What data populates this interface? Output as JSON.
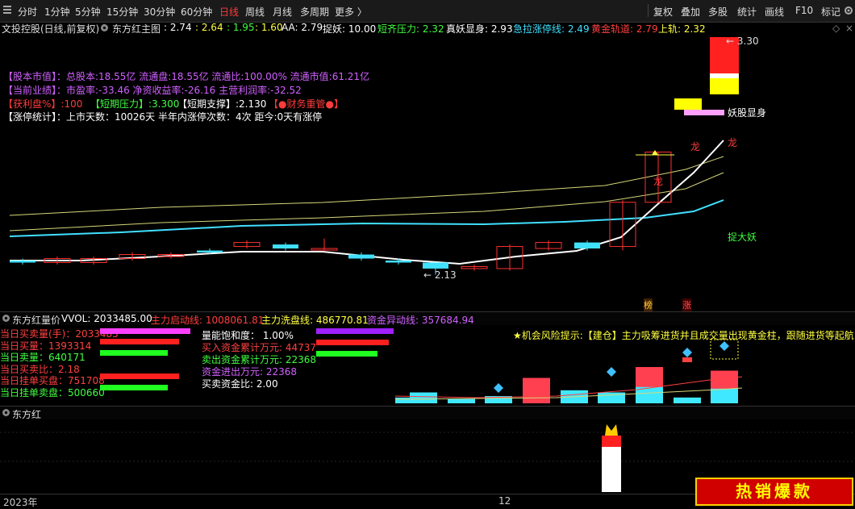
{
  "toolbar": {
    "menu_icon": "menu-icon",
    "tabs": [
      "分时",
      "1分钟",
      "5分钟",
      "15分钟",
      "30分钟",
      "60分钟",
      "日线",
      "周线",
      "月线",
      "多周期",
      "更多 〉"
    ],
    "right": [
      "复权",
      "叠加",
      "多股",
      "统计",
      "画线",
      "F10",
      "标记"
    ],
    "settings_icon": "gear-icon"
  },
  "main_header": {
    "stock": "文投控股(日线,前复权)",
    "indicator": "东方红主图",
    "vals": [
      ": 2.74",
      ": 2.64",
      ": 1.95",
      ": 1.60"
    ],
    "aa": "AA: 2.79",
    "zhuoyao": "捉妖: 10.00",
    "dqyl": "短齐压力: 2.32",
    "zyxs": "真妖显身: 2.93",
    "jlzt": "急拉涨停线: 2.49",
    "hjgd": "黄金轨道: 2.79",
    "sg": "上轨: 2.32"
  },
  "info_lines": {
    "l1": "【股本市值】：总股本:18.55亿 流通盘:18.55亿 流通比:100.00% 流通市值:61.21亿",
    "l2": "【当前业绩】：市盈率:-33.46 净资收益率:-26.16 主营利润率:-32.52",
    "l3a": "【获利盘%】:100",
    "l3b": "【短期压力】:3.300",
    "l3c": "【短期支撑】:2.130",
    "l3d": "【●财务重管●】",
    "l4": "【涨停统计】：上市天数：10026天 半年内涨停次数：4次   距今:0天有涨停"
  },
  "chart_labels": {
    "high": "← 3.30",
    "low": "← 2.13",
    "yao_show": "妖股显身",
    "long": "龙",
    "catch": "捉大妖",
    "bang": "榜",
    "zhang": "涨"
  },
  "vol_header": {
    "name": "东方红量价",
    "vvol": "VVOL: 2033485.00",
    "qd": "主力启动线: 1008061.81",
    "xp": "主力洗盘线: 486770.81",
    "yd": "资金异动线: 357684.94"
  },
  "vol_stats_left": [
    {
      "label": "当日买卖量(手)：2033485",
      "color": "#ff4040"
    },
    {
      "label": "当日买量：1393314",
      "color": "#ff4040"
    },
    {
      "label": "当日卖量：640171",
      "color": "#40ff40"
    },
    {
      "label": "当日买卖比：2.18",
      "color": "#ff4040"
    },
    {
      "label": "当日挂单买盘：751708",
      "color": "#ff4040"
    },
    {
      "label": "当日挂单卖盘：500660",
      "color": "#40ff40"
    }
  ],
  "vol_stats_mid": [
    {
      "label": "量能饱和度： 1.00%",
      "color": "#ffffff"
    },
    {
      "label": "买入资金累计万元: 44737",
      "color": "#ff4040"
    },
    {
      "label": "卖出资金累计万元: 22368",
      "color": "#40ff40"
    },
    {
      "label": "资金进出万元: 22368",
      "color": "#d060ff"
    },
    {
      "label": "买卖资金比: 2.00",
      "color": "#ffffff"
    }
  ],
  "vol_tip": "★机会风险提示:【建仓】主力吸筹进货并且成交量出现黄金柱，跟随进货等起航",
  "bottom_panel": {
    "name": "东方红"
  },
  "bottom_bar": {
    "year": "2023年",
    "month": "12"
  },
  "promo": "热销爆款",
  "chart_data": {
    "type": "candlestick",
    "price_range": [
      2.1,
      3.35
    ],
    "candles": [
      {
        "o": 2.2,
        "c": 2.19,
        "h": 2.21,
        "l": 2.18
      },
      {
        "o": 2.19,
        "c": 2.21,
        "h": 2.22,
        "l": 2.18
      },
      {
        "o": 2.19,
        "c": 2.21,
        "h": 2.22,
        "l": 2.18
      },
      {
        "o": 2.21,
        "c": 2.23,
        "h": 2.24,
        "l": 2.2
      },
      {
        "o": 2.22,
        "c": 2.23,
        "h": 2.24,
        "l": 2.21
      },
      {
        "o": 2.25,
        "c": 2.24,
        "h": 2.26,
        "l": 2.23
      },
      {
        "o": 2.27,
        "c": 2.29,
        "h": 2.3,
        "l": 2.26
      },
      {
        "o": 2.28,
        "c": 2.26,
        "h": 2.29,
        "l": 2.25
      },
      {
        "o": 2.26,
        "c": 2.26,
        "h": 2.31,
        "l": 2.25
      },
      {
        "o": 2.23,
        "c": 2.21,
        "h": 2.24,
        "l": 2.2
      },
      {
        "o": 2.2,
        "c": 2.19,
        "h": 2.21,
        "l": 2.18
      },
      {
        "o": 2.19,
        "c": 2.16,
        "h": 2.19,
        "l": 2.13
      },
      {
        "o": 2.16,
        "c": 2.17,
        "h": 2.18,
        "l": 2.15
      },
      {
        "o": 2.16,
        "c": 2.27,
        "h": 2.28,
        "l": 2.15
      },
      {
        "o": 2.26,
        "c": 2.29,
        "h": 2.3,
        "l": 2.25
      },
      {
        "o": 2.29,
        "c": 2.26,
        "h": 2.3,
        "l": 2.25
      },
      {
        "o": 2.27,
        "c": 2.49,
        "h": 2.5,
        "l": 2.25
      },
      {
        "o": 2.49,
        "c": 2.74,
        "h": 2.74,
        "l": 2.49
      },
      {
        "o": 2.74,
        "c": 3.3,
        "h": 3.3,
        "l": 2.74
      }
    ],
    "volume_bars": [
      0.08,
      0.15,
      0.06,
      0.1,
      0.35,
      0.18,
      0.15,
      0.5,
      0.08,
      0.45,
      0.85
    ],
    "bottom_bar_value": 0.72
  }
}
